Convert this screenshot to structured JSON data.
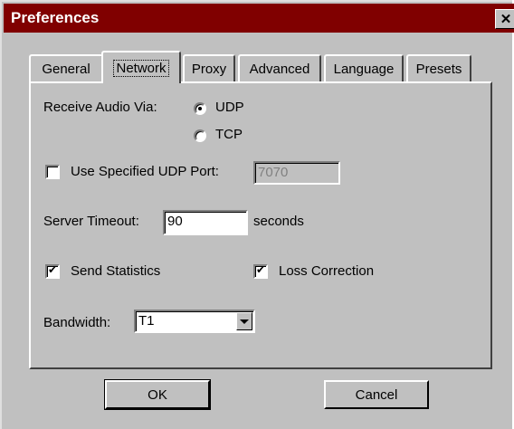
{
  "window": {
    "title": "Preferences",
    "close_glyph": "✕"
  },
  "tabs": [
    {
      "label": "General",
      "active": false
    },
    {
      "label": "Network",
      "active": true
    },
    {
      "label": "Proxy",
      "active": false
    },
    {
      "label": "Advanced",
      "active": false
    },
    {
      "label": "Language",
      "active": false
    },
    {
      "label": "Presets",
      "active": false
    }
  ],
  "network": {
    "receive_audio_label": "Receive Audio Via:",
    "transport_options": [
      {
        "label": "UDP",
        "selected": true
      },
      {
        "label": "TCP",
        "selected": false
      }
    ],
    "use_udp_port_label": "Use Specified UDP Port:",
    "use_udp_port_checked": false,
    "udp_port_value": "7070",
    "server_timeout_label": "Server Timeout:",
    "server_timeout_value": "90",
    "server_timeout_unit": "seconds",
    "send_statistics_label": "Send Statistics",
    "send_statistics_checked": true,
    "loss_correction_label": "Loss Correction",
    "loss_correction_checked": true,
    "bandwidth_label": "Bandwidth:",
    "bandwidth_value": "T1"
  },
  "buttons": {
    "ok": "OK",
    "cancel": "Cancel"
  },
  "colors": {
    "titlebar": "#800000",
    "face": "#c0c0c0"
  }
}
